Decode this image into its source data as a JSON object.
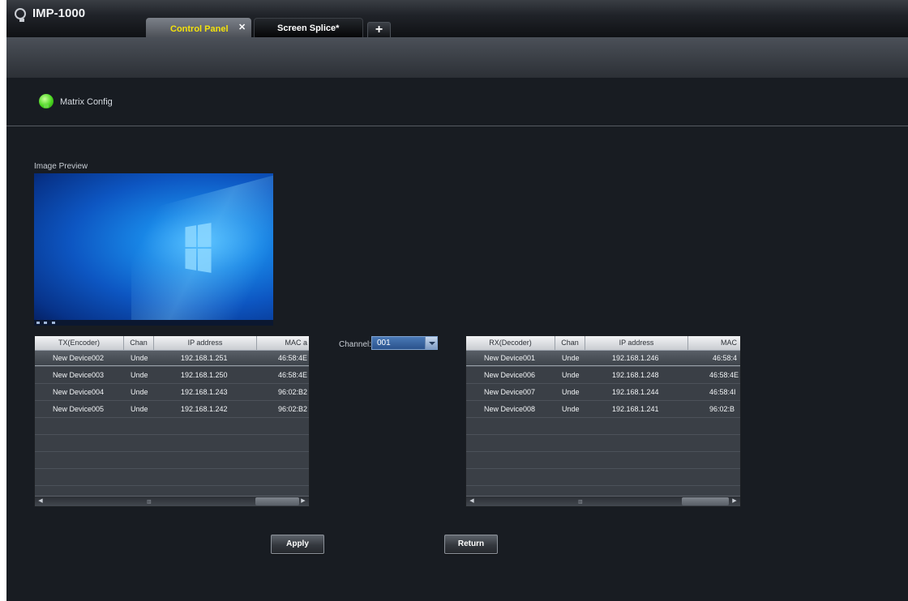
{
  "app": {
    "title": "IMP-1000"
  },
  "tabs": [
    {
      "label": "Control Panel",
      "active": true
    },
    {
      "label": "Screen Splice*",
      "active": false
    }
  ],
  "section": {
    "title": "Matrix Config",
    "icon": "green-dot-icon"
  },
  "preview": {
    "label": "Image Preview"
  },
  "channel": {
    "label": "Channel:",
    "value": "001"
  },
  "tx_table": {
    "headers": [
      "TX(Encoder)",
      "Chan",
      "IP address",
      "MAC a"
    ],
    "rows": [
      {
        "name": "New Device002",
        "chan": "Unde",
        "ip": "192.168.1.251",
        "mac": "46:58:4E"
      },
      {
        "name": "New Device003",
        "chan": "Unde",
        "ip": "192.168.1.250",
        "mac": "46:58:4E"
      },
      {
        "name": "New Device004",
        "chan": "Unde",
        "ip": "192.168.1.243",
        "mac": "96:02:B2"
      },
      {
        "name": "New Device005",
        "chan": "Unde",
        "ip": "192.168.1.242",
        "mac": "96:02:B2"
      }
    ]
  },
  "rx_table": {
    "headers": [
      "RX(Decoder)",
      "Chan",
      "IP address",
      "MAC"
    ],
    "rows": [
      {
        "name": "New Device001",
        "chan": "Unde",
        "ip": "192.168.1.246",
        "mac": "46:58:4"
      },
      {
        "name": "New Device006",
        "chan": "Unde",
        "ip": "192.168.1.248",
        "mac": "46:58:4E"
      },
      {
        "name": "New Device007",
        "chan": "Unde",
        "ip": "192.168.1.244",
        "mac": "46:58:4I"
      },
      {
        "name": "New Device008",
        "chan": "Unde",
        "ip": "192.168.1.241",
        "mac": "96:02:B"
      }
    ]
  },
  "buttons": {
    "apply": "Apply",
    "return": "Return"
  }
}
